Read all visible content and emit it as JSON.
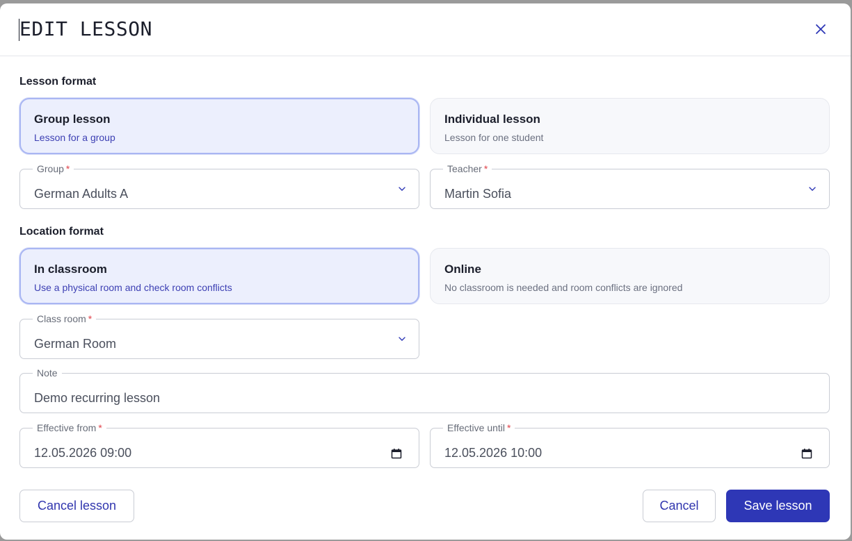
{
  "dialog": {
    "title": "EDIT LESSON"
  },
  "lesson_format": {
    "label": "Lesson format",
    "options": [
      {
        "title": "Group lesson",
        "description": "Lesson for a group",
        "selected": true
      },
      {
        "title": "Individual lesson",
        "description": "Lesson for one student",
        "selected": false
      }
    ]
  },
  "group_field": {
    "label": "Group",
    "required_mark": "*",
    "value": "German Adults A"
  },
  "teacher_field": {
    "label": "Teacher",
    "required_mark": "*",
    "value": "Martin Sofia"
  },
  "location_format": {
    "label": "Location format",
    "options": [
      {
        "title": "In classroom",
        "description": "Use a physical room and check room conflicts",
        "selected": true
      },
      {
        "title": "Online",
        "description": "No classroom is needed and room conflicts are ignored",
        "selected": false
      }
    ]
  },
  "classroom_field": {
    "label": "Class room",
    "required_mark": "*",
    "value": "German Room"
  },
  "note_field": {
    "label": "Note",
    "value": "Demo recurring lesson"
  },
  "effective_from": {
    "label": "Effective from",
    "required_mark": "*",
    "value": "12.05.2026 09:00"
  },
  "effective_until": {
    "label": "Effective until",
    "required_mark": "*",
    "value": "12.05.2026 10:00"
  },
  "footer": {
    "cancel_lesson": "Cancel lesson",
    "cancel": "Cancel",
    "save": "Save lesson"
  },
  "icons": {
    "close": "close-icon",
    "chevron": "chevron-down-icon",
    "calendar": "calendar-icon"
  },
  "colors": {
    "primary": "#2e37b6",
    "selected_bg": "#eceffd",
    "selected_border": "#a9b6f3",
    "required": "#e0424a"
  }
}
